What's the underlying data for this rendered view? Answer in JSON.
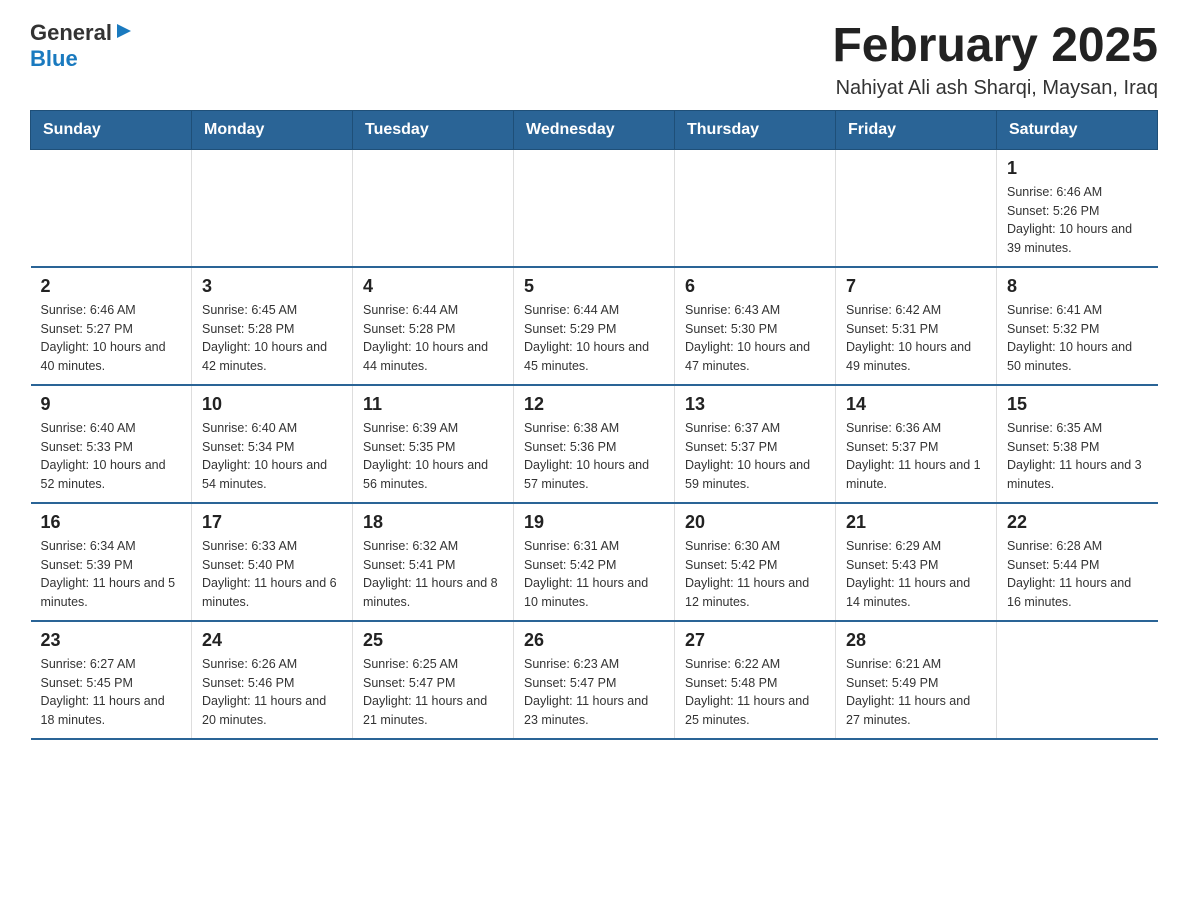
{
  "header": {
    "logo": {
      "text_general": "General",
      "text_blue": "Blue"
    },
    "title": "February 2025",
    "subtitle": "Nahiyat Ali ash Sharqi, Maysan, Iraq"
  },
  "days_of_week": [
    "Sunday",
    "Monday",
    "Tuesday",
    "Wednesday",
    "Thursday",
    "Friday",
    "Saturday"
  ],
  "weeks": [
    [
      {
        "day": "",
        "info": ""
      },
      {
        "day": "",
        "info": ""
      },
      {
        "day": "",
        "info": ""
      },
      {
        "day": "",
        "info": ""
      },
      {
        "day": "",
        "info": ""
      },
      {
        "day": "",
        "info": ""
      },
      {
        "day": "1",
        "info": "Sunrise: 6:46 AM\nSunset: 5:26 PM\nDaylight: 10 hours and 39 minutes."
      }
    ],
    [
      {
        "day": "2",
        "info": "Sunrise: 6:46 AM\nSunset: 5:27 PM\nDaylight: 10 hours and 40 minutes."
      },
      {
        "day": "3",
        "info": "Sunrise: 6:45 AM\nSunset: 5:28 PM\nDaylight: 10 hours and 42 minutes."
      },
      {
        "day": "4",
        "info": "Sunrise: 6:44 AM\nSunset: 5:28 PM\nDaylight: 10 hours and 44 minutes."
      },
      {
        "day": "5",
        "info": "Sunrise: 6:44 AM\nSunset: 5:29 PM\nDaylight: 10 hours and 45 minutes."
      },
      {
        "day": "6",
        "info": "Sunrise: 6:43 AM\nSunset: 5:30 PM\nDaylight: 10 hours and 47 minutes."
      },
      {
        "day": "7",
        "info": "Sunrise: 6:42 AM\nSunset: 5:31 PM\nDaylight: 10 hours and 49 minutes."
      },
      {
        "day": "8",
        "info": "Sunrise: 6:41 AM\nSunset: 5:32 PM\nDaylight: 10 hours and 50 minutes."
      }
    ],
    [
      {
        "day": "9",
        "info": "Sunrise: 6:40 AM\nSunset: 5:33 PM\nDaylight: 10 hours and 52 minutes."
      },
      {
        "day": "10",
        "info": "Sunrise: 6:40 AM\nSunset: 5:34 PM\nDaylight: 10 hours and 54 minutes."
      },
      {
        "day": "11",
        "info": "Sunrise: 6:39 AM\nSunset: 5:35 PM\nDaylight: 10 hours and 56 minutes."
      },
      {
        "day": "12",
        "info": "Sunrise: 6:38 AM\nSunset: 5:36 PM\nDaylight: 10 hours and 57 minutes."
      },
      {
        "day": "13",
        "info": "Sunrise: 6:37 AM\nSunset: 5:37 PM\nDaylight: 10 hours and 59 minutes."
      },
      {
        "day": "14",
        "info": "Sunrise: 6:36 AM\nSunset: 5:37 PM\nDaylight: 11 hours and 1 minute."
      },
      {
        "day": "15",
        "info": "Sunrise: 6:35 AM\nSunset: 5:38 PM\nDaylight: 11 hours and 3 minutes."
      }
    ],
    [
      {
        "day": "16",
        "info": "Sunrise: 6:34 AM\nSunset: 5:39 PM\nDaylight: 11 hours and 5 minutes."
      },
      {
        "day": "17",
        "info": "Sunrise: 6:33 AM\nSunset: 5:40 PM\nDaylight: 11 hours and 6 minutes."
      },
      {
        "day": "18",
        "info": "Sunrise: 6:32 AM\nSunset: 5:41 PM\nDaylight: 11 hours and 8 minutes."
      },
      {
        "day": "19",
        "info": "Sunrise: 6:31 AM\nSunset: 5:42 PM\nDaylight: 11 hours and 10 minutes."
      },
      {
        "day": "20",
        "info": "Sunrise: 6:30 AM\nSunset: 5:42 PM\nDaylight: 11 hours and 12 minutes."
      },
      {
        "day": "21",
        "info": "Sunrise: 6:29 AM\nSunset: 5:43 PM\nDaylight: 11 hours and 14 minutes."
      },
      {
        "day": "22",
        "info": "Sunrise: 6:28 AM\nSunset: 5:44 PM\nDaylight: 11 hours and 16 minutes."
      }
    ],
    [
      {
        "day": "23",
        "info": "Sunrise: 6:27 AM\nSunset: 5:45 PM\nDaylight: 11 hours and 18 minutes."
      },
      {
        "day": "24",
        "info": "Sunrise: 6:26 AM\nSunset: 5:46 PM\nDaylight: 11 hours and 20 minutes."
      },
      {
        "day": "25",
        "info": "Sunrise: 6:25 AM\nSunset: 5:47 PM\nDaylight: 11 hours and 21 minutes."
      },
      {
        "day": "26",
        "info": "Sunrise: 6:23 AM\nSunset: 5:47 PM\nDaylight: 11 hours and 23 minutes."
      },
      {
        "day": "27",
        "info": "Sunrise: 6:22 AM\nSunset: 5:48 PM\nDaylight: 11 hours and 25 minutes."
      },
      {
        "day": "28",
        "info": "Sunrise: 6:21 AM\nSunset: 5:49 PM\nDaylight: 11 hours and 27 minutes."
      },
      {
        "day": "",
        "info": ""
      }
    ]
  ]
}
